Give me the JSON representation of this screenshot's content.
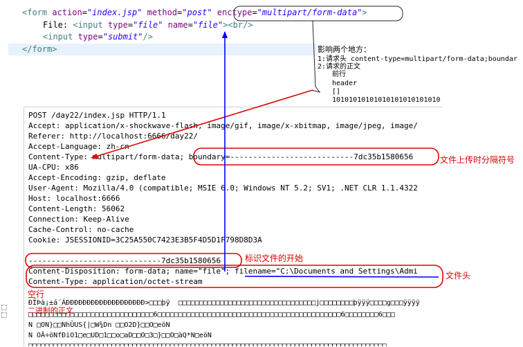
{
  "code": {
    "line1": {
      "open": "<form ",
      "a1": "action",
      "v1": "\"index.jsp\"",
      "a2": "method",
      "v2": "\"post\"",
      "a3": "enctype",
      "v3": "\"multipart/form-data\"",
      "close": ">"
    },
    "line2": {
      "text": "File: ",
      "open": "<input ",
      "a1": "type",
      "v1": "\"file\"",
      "a2": "name",
      "v2": "\"file\"",
      "close": "><br/>"
    },
    "line3": {
      "open": "<input ",
      "a1": "type",
      "v1": "\"submit\"",
      "close": "/>"
    },
    "line4": "</form>",
    "eq": "="
  },
  "notes": {
    "n1": "影响两个地方：",
    "n2": "1:请求头 content-type=multipart/form-data;boundar",
    "n3": "2:请求的正文",
    "n4": "前行",
    "n5": "header",
    "n6": "[]",
    "n7": "10101010101010101010101010"
  },
  "request": {
    "lines": [
      "POST /day22/index.jsp HTTP/1.1",
      "Accept: application/x-shockwave-flash, image/gif, image/x-xbitmap, image/jpeg, image/",
      "Referer: http://localhost:6666/day22/",
      "Accept-Language: zh-cn",
      "Content-Type: multipart/form-data; boundary=---------------------------7dc35b1580656",
      "UA-CPU: x86",
      "Accept-Encoding: gzip, deflate",
      "User-Agent: Mozilla/4.0 (compatible; MSIE 6.0; Windows NT 5.2; SV1; .NET CLR 1.1.4322",
      "Host: localhost:6666",
      "Content-Length: 56062",
      "Connection: Keep-Alive",
      "Cache-Control: no-cache",
      "Cookie: JSESSIONID=3C25A550C7423E3B5F4D5D1F798D8D3A",
      "",
      "-----------------------------7dc35b1580656",
      "Content-Disposition: form-data; name=\"file\"; filename=\"C:\\Documents and Settings\\Admi",
      "Content-Type: application/octet-stream"
    ],
    "binary": [
      "ÐÏÞà¡±á´ÁÐÐÐÐÐÐÐÐÐÐÐÐÐÐÐÐÐÐÐ>□□□þÿ  □□□□□□□□□□□□□□□□□□□□□□□□□□□□□□□□□j□□□□□□□□þÿÿÿ□□□□g□□□ÿÿÿÿ",
      "□□□□□□□□□□□□□□□□□□□□□□□□□□□□□□6□□□□□□□□□□□□□□□□□□□□□□□□□□□□□□□□□□□□□□□□□□□□6□□□□□□□□6□□□",
      "N □ON}□□NhÛUS{|□W¾Dn □□O2D}□□O□eöN",
      "N OÂ÷öNfÐiO1□e□UD□1□□o□aD□□O□3□}□□O□àQ*N□eöN",
      "□□□□□□□□□□□□□□□□□□□□□□□□□□□□□□□□□□□□□□□□□□□□□□□□□□□□□□□□□□□□□□□□□□□□□□□□□□□□□□□□□□□□□□"
    ]
  },
  "annotations": {
    "boundary_label": "文件上传时分隔符号",
    "start_label": "标识文件的开始",
    "filehead_label": "文件头",
    "blank_label": "空行",
    "binary_label": "二进制的正文"
  },
  "colors": {
    "annotation_red": "#e00000",
    "arrow_blue": "#0000ff",
    "tag": "#3f7f7f",
    "attribute": "#7f007f",
    "value": "#2a00ff",
    "highlight_line": "#e8f2fe"
  }
}
